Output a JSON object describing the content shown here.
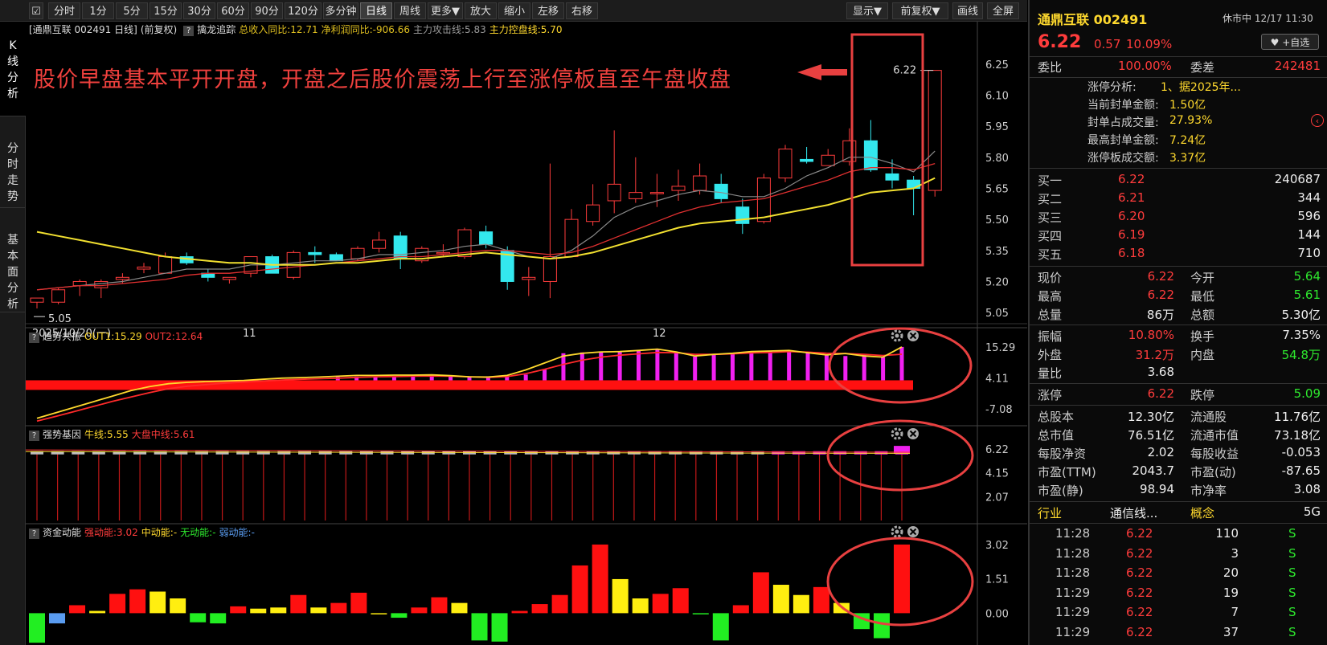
{
  "toolbar": {
    "periods": [
      "分时",
      "1分",
      "5分",
      "15分",
      "30分",
      "60分",
      "90分",
      "120分",
      "多分钟",
      "日线",
      "周线",
      "更多▼",
      "放大",
      "缩小",
      "左移",
      "右移"
    ],
    "right_items": [
      "显示▼",
      "前复权▼",
      "画线",
      "全屏"
    ]
  },
  "side_tabs": [
    "K线分析",
    "分时走势",
    "基本面分析"
  ],
  "main_header": {
    "title": "[通鼎互联 002491 日线]",
    "adjust": "(前复权)",
    "help": "?",
    "indicator": "擒龙追踪",
    "items": [
      {
        "text": "总收入同比:12.71",
        "color": "#e0c020"
      },
      {
        "text": "净利润同比:-906.66",
        "color": "#e0c020"
      },
      {
        "text": "主力攻击线:5.83",
        "color": "#9a9a9a"
      },
      {
        "text": "主力控盘线:5.70",
        "color": "#ffd92e"
      }
    ]
  },
  "annotation": "股价早盘基本平开开盘，开盘之后股价震荡上行至涨停板直至午盘收盘",
  "chart_data": [
    {
      "type": "candlestick",
      "ylim": [
        5.0,
        6.3
      ],
      "y_ticks": [
        6.25,
        6.1,
        5.95,
        5.8,
        5.65,
        5.5,
        5.35,
        5.2,
        5.05
      ],
      "x_tick_labels": [
        "2025/10/20(一)",
        "11",
        "12"
      ],
      "min_label": "5.05",
      "max_label": "6.22",
      "candles": [
        {
          "o": 5.1,
          "h": 5.12,
          "l": 5.07,
          "c": 5.12
        },
        {
          "o": 5.1,
          "h": 5.17,
          "l": 5.09,
          "c": 5.16
        },
        {
          "o": 5.18,
          "h": 5.21,
          "l": 5.13,
          "c": 5.2
        },
        {
          "o": 5.17,
          "h": 5.21,
          "l": 5.12,
          "c": 5.2
        },
        {
          "o": 5.21,
          "h": 5.24,
          "l": 5.19,
          "c": 5.22
        },
        {
          "o": 5.26,
          "h": 5.29,
          "l": 5.24,
          "c": 5.27
        },
        {
          "o": 5.24,
          "h": 5.34,
          "l": 5.24,
          "c": 5.32
        },
        {
          "o": 5.32,
          "h": 5.34,
          "l": 5.28,
          "c": 5.29
        },
        {
          "o": 5.24,
          "h": 5.26,
          "l": 5.2,
          "c": 5.22
        },
        {
          "o": 5.21,
          "h": 5.22,
          "l": 5.19,
          "c": 5.22
        },
        {
          "o": 5.24,
          "h": 5.31,
          "l": 5.22,
          "c": 5.32
        },
        {
          "o": 5.32,
          "h": 5.33,
          "l": 5.24,
          "c": 5.24
        },
        {
          "o": 5.22,
          "h": 5.35,
          "l": 5.21,
          "c": 5.34
        },
        {
          "o": 5.34,
          "h": 5.37,
          "l": 5.29,
          "c": 5.33
        },
        {
          "o": 5.33,
          "h": 5.34,
          "l": 5.31,
          "c": 5.3
        },
        {
          "o": 5.31,
          "h": 5.37,
          "l": 5.3,
          "c": 5.36
        },
        {
          "o": 5.36,
          "h": 5.44,
          "l": 5.34,
          "c": 5.4
        },
        {
          "o": 5.42,
          "h": 5.44,
          "l": 5.26,
          "c": 5.31
        },
        {
          "o": 5.3,
          "h": 5.37,
          "l": 5.29,
          "c": 5.36
        },
        {
          "o": 5.34,
          "h": 5.38,
          "l": 5.32,
          "c": 5.34
        },
        {
          "o": 5.32,
          "h": 5.46,
          "l": 5.31,
          "c": 5.45
        },
        {
          "o": 5.44,
          "h": 5.47,
          "l": 5.36,
          "c": 5.38
        },
        {
          "o": 5.35,
          "h": 5.37,
          "l": 5.16,
          "c": 5.2
        },
        {
          "o": 5.21,
          "h": 5.27,
          "l": 5.13,
          "c": 5.22
        },
        {
          "o": 5.2,
          "h": 5.77,
          "l": 5.12,
          "c": 5.32
        },
        {
          "o": 5.32,
          "h": 5.55,
          "l": 5.32,
          "c": 5.5
        },
        {
          "o": 5.49,
          "h": 5.67,
          "l": 5.47,
          "c": 5.57
        },
        {
          "o": 5.59,
          "h": 5.93,
          "l": 5.53,
          "c": 5.67
        },
        {
          "o": 5.6,
          "h": 5.8,
          "l": 5.58,
          "c": 5.63
        },
        {
          "o": 5.63,
          "h": 5.72,
          "l": 5.56,
          "c": 5.63
        },
        {
          "o": 5.64,
          "h": 5.74,
          "l": 5.59,
          "c": 5.66
        },
        {
          "o": 5.64,
          "h": 5.77,
          "l": 5.62,
          "c": 5.71
        },
        {
          "o": 5.67,
          "h": 5.72,
          "l": 5.58,
          "c": 5.6
        },
        {
          "o": 5.56,
          "h": 5.6,
          "l": 5.43,
          "c": 5.48
        },
        {
          "o": 5.49,
          "h": 5.72,
          "l": 5.48,
          "c": 5.7
        },
        {
          "o": 5.7,
          "h": 5.86,
          "l": 5.68,
          "c": 5.84
        },
        {
          "o": 5.79,
          "h": 5.85,
          "l": 5.77,
          "c": 5.78
        },
        {
          "o": 5.76,
          "h": 5.84,
          "l": 5.76,
          "c": 5.81
        },
        {
          "o": 5.78,
          "h": 5.94,
          "l": 5.76,
          "c": 5.88
        },
        {
          "o": 5.88,
          "h": 5.98,
          "l": 5.73,
          "c": 5.74
        },
        {
          "o": 5.72,
          "h": 5.79,
          "l": 5.65,
          "c": 5.69
        },
        {
          "o": 5.69,
          "h": 5.71,
          "l": 5.52,
          "c": 5.65
        },
        {
          "o": 5.64,
          "h": 6.22,
          "l": 5.61,
          "c": 6.22
        }
      ],
      "ma_gray": [
        5.16,
        5.17,
        5.18,
        5.19,
        5.2,
        5.22,
        5.24,
        5.26,
        5.26,
        5.26,
        5.28,
        5.28,
        5.29,
        5.3,
        5.3,
        5.31,
        5.33,
        5.33,
        5.34,
        5.35,
        5.37,
        5.38,
        5.35,
        5.32,
        5.31,
        5.35,
        5.42,
        5.51,
        5.56,
        5.59,
        5.62,
        5.64,
        5.63,
        5.61,
        5.61,
        5.65,
        5.71,
        5.75,
        5.8,
        5.8,
        5.77,
        5.73,
        5.83
      ],
      "ma_red": [
        5.16,
        5.17,
        5.18,
        5.18,
        5.19,
        5.2,
        5.21,
        5.23,
        5.24,
        5.24,
        5.25,
        5.26,
        5.27,
        5.28,
        5.29,
        5.3,
        5.31,
        5.32,
        5.32,
        5.33,
        5.34,
        5.35,
        5.35,
        5.34,
        5.33,
        5.34,
        5.37,
        5.41,
        5.45,
        5.49,
        5.53,
        5.56,
        5.58,
        5.59,
        5.6,
        5.63,
        5.66,
        5.69,
        5.73,
        5.75,
        5.75,
        5.74,
        5.77
      ],
      "ma_yellow": [
        5.44,
        5.42,
        5.4,
        5.38,
        5.36,
        5.34,
        5.32,
        5.31,
        5.3,
        5.29,
        5.29,
        5.28,
        5.28,
        5.28,
        5.29,
        5.29,
        5.3,
        5.31,
        5.31,
        5.32,
        5.33,
        5.34,
        5.33,
        5.32,
        5.31,
        5.32,
        5.34,
        5.37,
        5.4,
        5.43,
        5.46,
        5.48,
        5.49,
        5.5,
        5.51,
        5.53,
        5.55,
        5.57,
        5.6,
        5.63,
        5.64,
        5.65,
        5.7
      ]
    },
    {
      "type": "bar",
      "title": "趋势共振",
      "legend": [
        {
          "text": "OUT1:15.29",
          "color": "#ffd92e"
        },
        {
          "text": "OUT2:12.64",
          "color": "#ff3c3c"
        }
      ],
      "y_ticks": [
        15.29,
        4.11,
        -7.08
      ],
      "ylim": [
        -12,
        17
      ],
      "base_value": 1.5,
      "out1": [
        -10.5,
        -8.5,
        -6.5,
        -4.5,
        -2.5,
        -0.5,
        1.0,
        2.0,
        2.5,
        2.8,
        3.0,
        3.2,
        3.6,
        4.0,
        4.2,
        4.4,
        4.7,
        5.0,
        5.0,
        5.1,
        5.1,
        5.2,
        4.9,
        4.5,
        4.4,
        5.0,
        7.0,
        9.5,
        12.0,
        13.0,
        13.5,
        13.6,
        14.0,
        14.5,
        13.5,
        12.0,
        12.6,
        13.0,
        13.6,
        13.8,
        14.0,
        13.2,
        12.4,
        12.9,
        12.0,
        11.6,
        15.29
      ],
      "out2": [
        -11.5,
        -9.8,
        -8.0,
        -6.2,
        -4.4,
        -2.8,
        -1.2,
        0.2,
        1.1,
        1.7,
        2.2,
        2.6,
        3.0,
        3.3,
        3.6,
        3.8,
        4.0,
        4.3,
        4.5,
        4.6,
        4.7,
        4.8,
        4.7,
        4.5,
        4.3,
        4.6,
        5.6,
        7.2,
        9.0,
        10.5,
        11.6,
        12.3,
        12.8,
        13.3,
        13.2,
        12.6,
        12.6,
        12.8,
        13.1,
        13.3,
        13.6,
        13.4,
        13.0,
        12.9,
        12.6,
        12.2,
        12.64
      ],
      "bars": [
        0,
        0,
        0,
        0,
        0,
        0,
        0,
        0,
        0,
        0,
        0,
        0,
        0,
        0,
        0,
        0,
        4.5,
        4.6,
        4.6,
        4.7,
        4.7,
        4.8,
        4.8,
        4.7,
        4.7,
        4.7,
        5.3,
        7.3,
        13.0,
        13.3,
        13.5,
        13.6,
        14.0,
        14.3,
        13.2,
        11.8,
        12.6,
        13.1,
        13.6,
        13.8,
        14.0,
        13.4,
        12.4,
        12.0,
        12.6,
        11.6,
        15.29
      ]
    },
    {
      "type": "bar",
      "title": "强势基因",
      "legend": [
        {
          "text": "牛线:5.55",
          "color": "#ffd92e"
        },
        {
          "text": "大盘中线:5.61",
          "color": "#ff3c3c"
        }
      ],
      "y_ticks": [
        6.22,
        4.15,
        2.07
      ],
      "ylim": [
        0,
        7
      ],
      "stick_count": 43
    },
    {
      "type": "bar",
      "title": "资金动能",
      "legend": [
        {
          "text": "强动能:3.02",
          "color": "#ff3c3c"
        },
        {
          "text": "中动能:-",
          "color": "#ffd92e"
        },
        {
          "text": "无动能:-",
          "color": "#2ee82e"
        },
        {
          "text": "弱动能:-",
          "color": "#5a9cf0"
        }
      ],
      "y_ticks": [
        3.02,
        1.51,
        0.0
      ],
      "ylim": [
        -1.4,
        3.3
      ],
      "values": [
        -1.3,
        -0.45,
        0.35,
        0.1,
        0.85,
        1.05,
        0.95,
        0.65,
        -0.4,
        -0.45,
        0.3,
        0.2,
        0.25,
        0.8,
        0.25,
        0.45,
        0.9,
        -0.05,
        -0.2,
        0.25,
        0.7,
        0.45,
        -1.2,
        -1.25,
        0.1,
        0.4,
        0.8,
        2.1,
        3.02,
        1.5,
        0.65,
        0.85,
        1.1,
        -0.05,
        -1.2,
        0.35,
        1.8,
        1.25,
        0.8,
        1.15,
        0.45,
        -0.7,
        -1.1,
        3.02
      ],
      "colors": [
        "green",
        "blue",
        "red",
        "yellow",
        "red",
        "red",
        "yellow",
        "yellow",
        "green",
        "green",
        "red",
        "yellow",
        "yellow",
        "red",
        "yellow",
        "red",
        "red",
        "yellow",
        "green",
        "red",
        "red",
        "yellow",
        "green",
        "green",
        "red",
        "red",
        "red",
        "red",
        "red",
        "yellow",
        "yellow",
        "red",
        "red",
        "green",
        "green",
        "red",
        "red",
        "yellow",
        "yellow",
        "red",
        "yellow",
        "green",
        "green",
        "red"
      ]
    }
  ],
  "quote": {
    "name": "通鼎互联 002491",
    "status": "休市中 12/17 11:30",
    "price": "6.22",
    "change": "0.57",
    "pct": "10.09%",
    "watch": "♥ +自选",
    "weibi_label": "委比",
    "weibi": "100.00%",
    "weicha_label": "委差",
    "weicha": "242481",
    "limit_info": [
      {
        "label": "涨停分析:",
        "value": "1、据2025年..."
      },
      {
        "label": "当前封单金额:",
        "value": "1.50亿"
      },
      {
        "label": "封单占成交量:",
        "value": "27.93%"
      },
      {
        "label": "最高封单金额:",
        "value": "7.24亿"
      },
      {
        "label": "涨停板成交额:",
        "value": "3.37亿"
      }
    ],
    "bids": [
      {
        "label": "买一",
        "price": "6.22",
        "vol": "240687"
      },
      {
        "label": "买二",
        "price": "6.21",
        "vol": "344"
      },
      {
        "label": "买三",
        "price": "6.20",
        "vol": "596"
      },
      {
        "label": "买四",
        "price": "6.19",
        "vol": "144"
      },
      {
        "label": "买五",
        "price": "6.18",
        "vol": "710"
      }
    ],
    "stats1": [
      {
        "l1": "现价",
        "v1": "6.22",
        "c1": "red",
        "l2": "今开",
        "v2": "5.64",
        "c2": "green"
      },
      {
        "l1": "最高",
        "v1": "6.22",
        "c1": "red",
        "l2": "最低",
        "v2": "5.61",
        "c2": "green"
      },
      {
        "l1": "总量",
        "v1": "86万",
        "c1": "white",
        "l2": "总额",
        "v2": "5.30亿",
        "c2": "white"
      }
    ],
    "stats2": [
      {
        "l1": "振幅",
        "v1": "10.80%",
        "c1": "red",
        "l2": "换手",
        "v2": "7.35%",
        "c2": "white"
      },
      {
        "l1": "外盘",
        "v1": "31.2万",
        "c1": "red",
        "l2": "内盘",
        "v2": "54.8万",
        "c2": "green"
      },
      {
        "l1": "量比",
        "v1": "3.68",
        "c1": "white",
        "l2": "",
        "v2": "",
        "c2": "white"
      }
    ],
    "stats3": [
      {
        "l1": "涨停",
        "v1": "6.22",
        "c1": "red",
        "l2": "跌停",
        "v2": "5.09",
        "c2": "green"
      }
    ],
    "stats4": [
      {
        "l1": "总股本",
        "v1": "12.30亿",
        "c1": "white",
        "l2": "流通股",
        "v2": "11.76亿",
        "c2": "white"
      },
      {
        "l1": "总市值",
        "v1": "76.51亿",
        "c1": "white",
        "l2": "流通市值",
        "v2": "73.18亿",
        "c2": "white"
      },
      {
        "l1": "每股净资",
        "v1": "2.02",
        "c1": "white",
        "l2": "每股收益",
        "v2": "-0.053",
        "c2": "white"
      },
      {
        "l1": "市盈(TTM)",
        "v1": "2043.7",
        "c1": "white",
        "l2": "市盈(动)",
        "v2": "-87.65",
        "c2": "white"
      },
      {
        "l1": "市盈(静)",
        "v1": "98.94",
        "c1": "white",
        "l2": "市净率",
        "v2": "3.08",
        "c2": "white"
      }
    ],
    "industry_label": "行业",
    "industry": "通信线...",
    "concept_label": "概念",
    "concept": "5G",
    "ticks": [
      {
        "time": "11:28",
        "price": "6.22",
        "vol": "110",
        "side": "S"
      },
      {
        "time": "11:28",
        "price": "6.22",
        "vol": "3",
        "side": "S"
      },
      {
        "time": "11:28",
        "price": "6.22",
        "vol": "20",
        "side": "S"
      },
      {
        "time": "11:29",
        "price": "6.22",
        "vol": "19",
        "side": "S"
      },
      {
        "time": "11:29",
        "price": "6.22",
        "vol": "7",
        "side": "S"
      },
      {
        "time": "11:29",
        "price": "6.22",
        "vol": "37",
        "side": "S"
      }
    ]
  }
}
